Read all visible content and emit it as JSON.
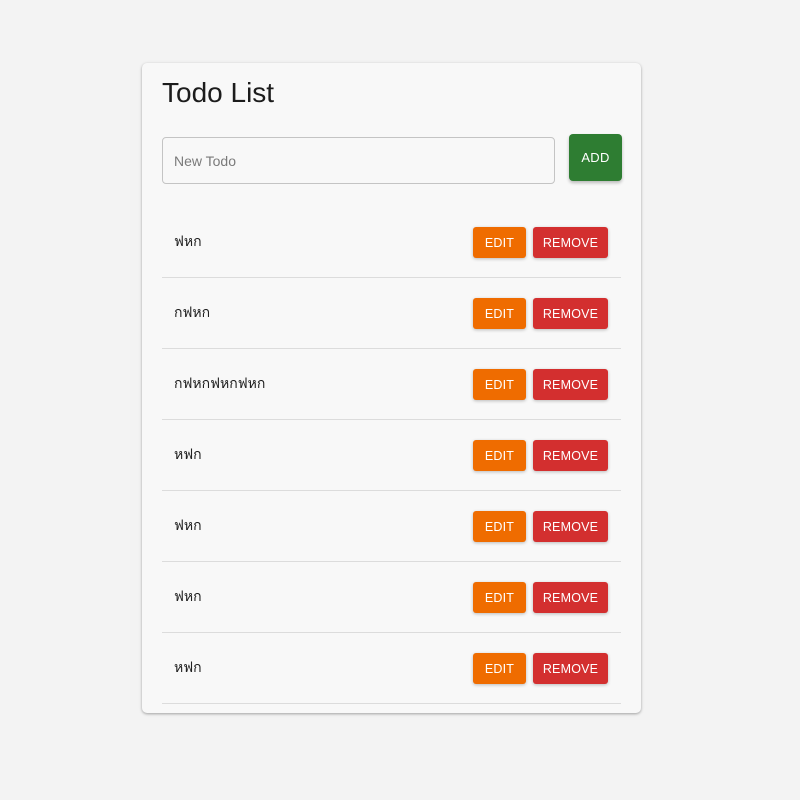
{
  "header": {
    "title": "Todo List"
  },
  "add_form": {
    "placeholder": "New Todo",
    "value": "",
    "add_label": "ADD"
  },
  "todos": [
    {
      "text": "ฟหก",
      "edit_label": "EDIT",
      "remove_label": "REMOVE"
    },
    {
      "text": "กฟหก",
      "edit_label": "EDIT",
      "remove_label": "REMOVE"
    },
    {
      "text": "กฟหกฟหกฟหก",
      "edit_label": "EDIT",
      "remove_label": "REMOVE"
    },
    {
      "text": "หฟก",
      "edit_label": "EDIT",
      "remove_label": "REMOVE"
    },
    {
      "text": "ฟหก",
      "edit_label": "EDIT",
      "remove_label": "REMOVE"
    },
    {
      "text": "ฟหก",
      "edit_label": "EDIT",
      "remove_label": "REMOVE"
    },
    {
      "text": "หฟก",
      "edit_label": "EDIT",
      "remove_label": "REMOVE"
    }
  ],
  "colors": {
    "add": "#2e7d32",
    "edit": "#ef6c00",
    "remove": "#d32f2f",
    "background": "#f3f3f3",
    "card": "#f8f8f8"
  }
}
